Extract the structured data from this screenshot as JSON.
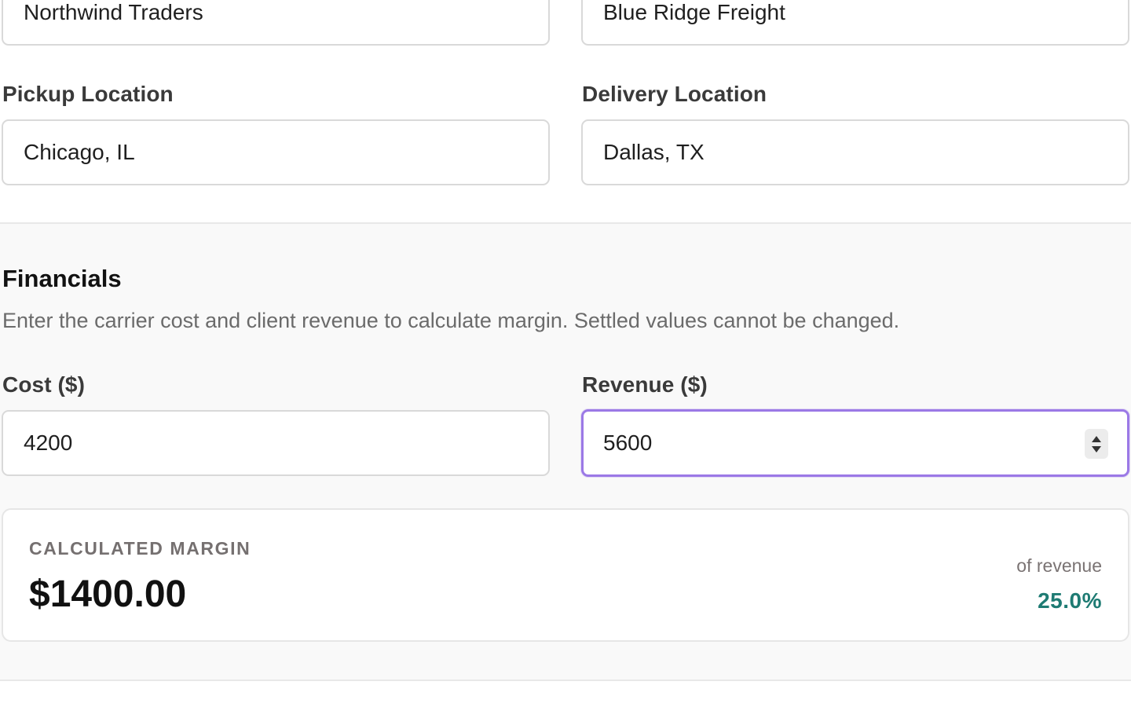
{
  "parties": {
    "client_value": "Northwind Traders",
    "carrier_value": "Blue Ridge Freight"
  },
  "locations": {
    "pickup_label": "Pickup Location",
    "pickup_value": "Chicago, IL",
    "delivery_label": "Delivery Location",
    "delivery_value": "Dallas, TX"
  },
  "financials": {
    "title": "Financials",
    "description": "Enter the carrier cost and client revenue to calculate margin. Settled values cannot be changed.",
    "cost_label": "Cost ($)",
    "cost_value": "4200",
    "revenue_label": "Revenue ($)",
    "revenue_value": "5600",
    "stepper_icon": "stepper-icon"
  },
  "margin": {
    "label": "CALCULATED MARGIN",
    "value": "$1400.00",
    "percent_caption": "of revenue",
    "percent_value": "25.0%"
  },
  "colors": {
    "focus_border": "#9b79e6",
    "percent_text": "#1e7b73",
    "section_bg": "#f9f9f9"
  }
}
